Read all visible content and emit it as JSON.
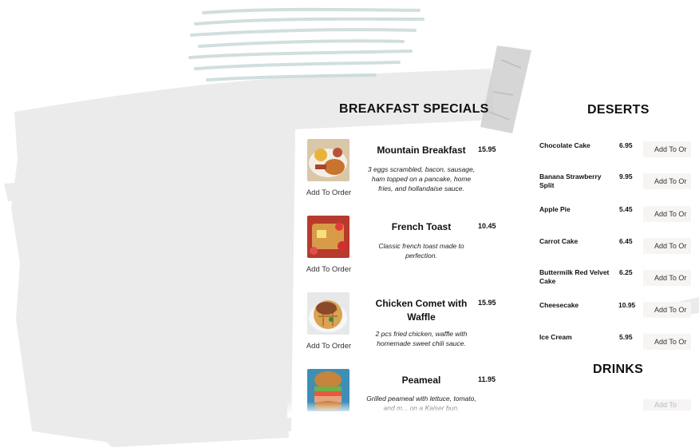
{
  "breakfast": {
    "title": "BREAKFAST SPECIALS",
    "items": [
      {
        "name": "Mountain Breakfast",
        "price": "15.95",
        "description": "3 eggs scrambled, bacon, sausage, ham topped on a pancake, home fries, and hollandaise sauce.",
        "add_label": "Add To Order",
        "image": "mountain-breakfast-photo"
      },
      {
        "name": "French Toast",
        "price": "10.45",
        "description": "Classic french toast made to perfection.",
        "add_label": "Add To Order",
        "image": "french-toast-photo"
      },
      {
        "name": "Chicken Comet with Waffle",
        "price": "15.95",
        "description": "2 pcs fried chicken, waffle with homemade sweet chili sauce.",
        "add_label": "Add To Order",
        "image": "chicken-waffle-photo"
      },
      {
        "name": "Peameal",
        "price": "11.95",
        "description": "Grilled peameal with lettuce, tomato, and m... on a Kaiser bun.",
        "add_label": "",
        "image": "peameal-sandwich-photo"
      }
    ]
  },
  "desserts": {
    "title": "DESERTS",
    "items": [
      {
        "name": "Chocolate Cake",
        "price": "6.95",
        "add_label": "Add To Or"
      },
      {
        "name": "Banana Strawberry Split",
        "price": "9.95",
        "add_label": "Add To Or"
      },
      {
        "name": "Apple Pie",
        "price": "5.45",
        "add_label": "Add To Or"
      },
      {
        "name": "Carrot Cake",
        "price": "6.45",
        "add_label": "Add To Or"
      },
      {
        "name": "Buttermilk Red Velvet Cake",
        "price": "6.25",
        "add_label": "Add To Or"
      },
      {
        "name": "Cheesecake",
        "price": "10.95",
        "add_label": "Add To Or"
      },
      {
        "name": "Ice Cream",
        "price": "5.95",
        "add_label": "Add To Or"
      }
    ]
  },
  "drinks": {
    "title": "DRINKS",
    "add_label": "Add To"
  },
  "colors": {
    "brush_gray": "#ebebeb",
    "brush_teal": "#c9d9d9",
    "tape_gray": "#cfcfcf",
    "button_bg": "#f7f4f4"
  }
}
